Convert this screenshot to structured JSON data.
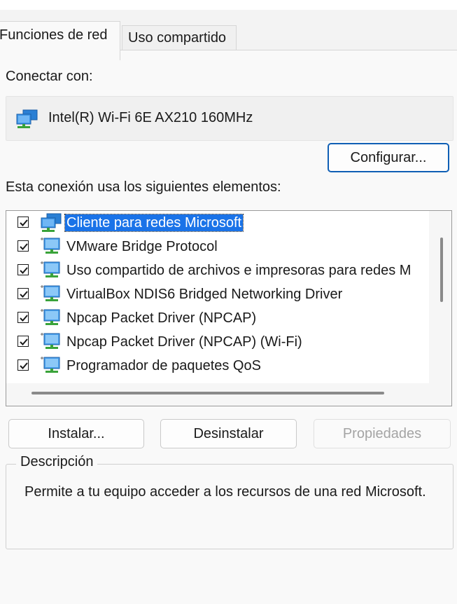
{
  "tabs": [
    {
      "label": "Funciones de red",
      "active": true
    },
    {
      "label": "Uso compartido",
      "active": false
    }
  ],
  "connect": {
    "label": "Conectar con:",
    "adapter_name": "Intel(R) Wi-Fi 6E AX210 160MHz",
    "adapter_icon": "network-adapter-icon"
  },
  "configure_label": "Configurar...",
  "items_label": "Esta conexión usa los siguientes elementos:",
  "items": [
    {
      "label": "Cliente para redes Microsoft",
      "checked": true,
      "selected": true,
      "icon": "network-client-icon"
    },
    {
      "label": "VMware Bridge Protocol",
      "checked": true,
      "selected": false,
      "icon": "network-protocol-icon"
    },
    {
      "label": "Uso compartido de archivos e impresoras para redes M",
      "checked": true,
      "selected": false,
      "icon": "network-service-icon"
    },
    {
      "label": "VirtualBox NDIS6 Bridged Networking Driver",
      "checked": true,
      "selected": false,
      "icon": "network-protocol-icon"
    },
    {
      "label": "Npcap Packet Driver (NPCAP)",
      "checked": true,
      "selected": false,
      "icon": "network-protocol-icon"
    },
    {
      "label": "Npcap Packet Driver (NPCAP) (Wi-Fi)",
      "checked": true,
      "selected": false,
      "icon": "network-protocol-icon"
    },
    {
      "label": "Programador de paquetes QoS",
      "checked": true,
      "selected": false,
      "icon": "network-service-icon"
    }
  ],
  "buttons": {
    "install": "Instalar...",
    "uninstall": "Desinstalar",
    "properties": "Propiedades"
  },
  "description": {
    "title": "Descripción",
    "text": "Permite a tu equipo acceder a los recursos de una red Microsoft."
  },
  "colors": {
    "selection": "#1a73e8",
    "primary_border": "#0f5fb5"
  }
}
